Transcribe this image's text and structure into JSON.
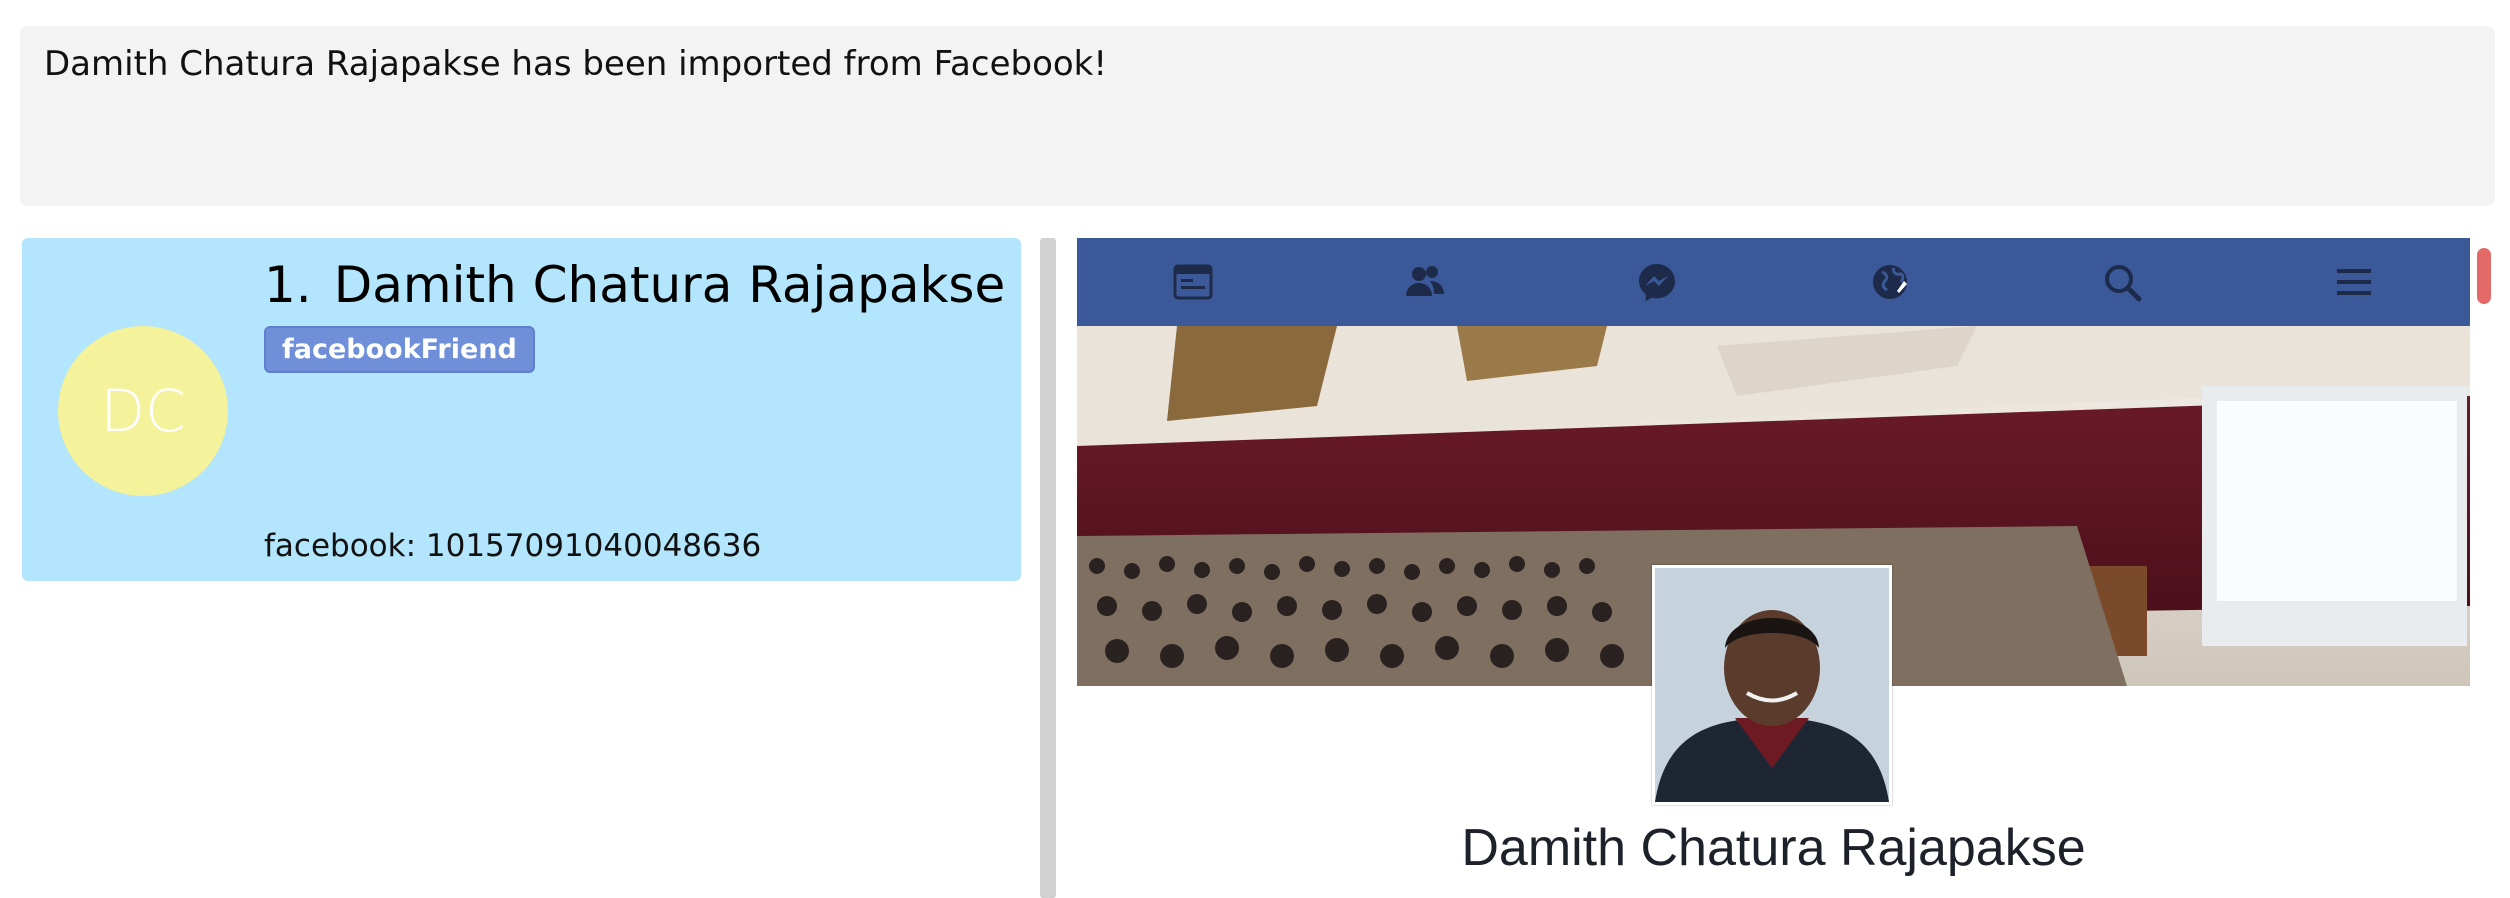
{
  "result": {
    "message": "Damith Chatura Rajapakse has been imported from Facebook!"
  },
  "person_list": {
    "cards": [
      {
        "index": "1.",
        "name": "Damith Chatura Rajapakse",
        "initials": "DC",
        "tag": "facebookFriend",
        "field": "facebook: 10157091040048636"
      }
    ]
  },
  "browser": {
    "nav_icons": [
      "news-feed-icon",
      "friends-icon",
      "messenger-icon",
      "notifications-globe-icon",
      "search-icon",
      "menu-icon"
    ],
    "nav_color": "#3b5998",
    "profile_name": "Damith Chatura Rajapakse"
  },
  "colors": {
    "card_background": "#b3e5fc",
    "avatar_background": "#f4f29a",
    "tag_background": "#6f8fd9",
    "result_background": "#f3f3f3"
  }
}
